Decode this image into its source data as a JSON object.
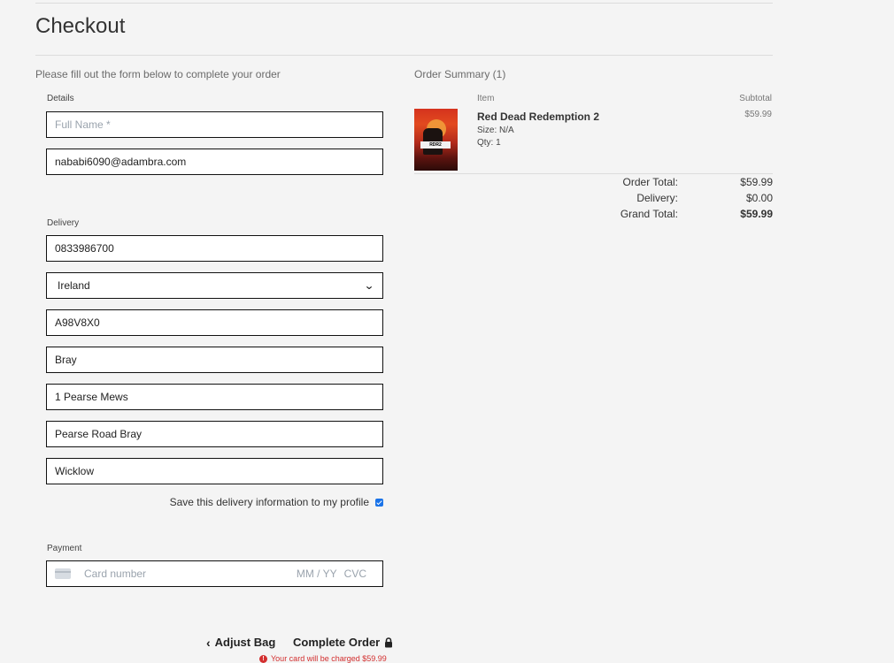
{
  "page_title": "Checkout",
  "form_intro": "Please fill out the form below to complete your order",
  "details": {
    "section_label": "Details",
    "full_name_placeholder": "Full Name *",
    "email_value": "nababi6090@adambra.com"
  },
  "delivery": {
    "section_label": "Delivery",
    "phone": "0833986700",
    "country": "Ireland",
    "postcode": "A98V8X0",
    "town": "Bray",
    "street1": "1 Pearse Mews",
    "street2": "Pearse Road Bray",
    "county": "Wicklow",
    "save_label": "Save this delivery information to my profile",
    "save_checked": true
  },
  "payment": {
    "section_label": "Payment",
    "card_placeholder": "Card number",
    "expiry_placeholder": "MM / YY",
    "cvc_placeholder": "CVC"
  },
  "actions": {
    "adjust_bag": "Adjust Bag",
    "complete_order": "Complete Order",
    "charge_warning": "Your card will be charged $59.99"
  },
  "order_summary": {
    "title": "Order Summary (1)",
    "item_header": "Item",
    "subtotal_header": "Subtotal",
    "items": [
      {
        "name": "Red Dead Redemption 2",
        "size": "Size: N/A",
        "qty": "Qty: 1",
        "subtotal": "$59.99"
      }
    ],
    "order_total_label": "Order Total:",
    "order_total": "$59.99",
    "delivery_label": "Delivery:",
    "delivery_cost": "$0.00",
    "grand_total_label": "Grand Total:",
    "grand_total": "$59.99"
  }
}
